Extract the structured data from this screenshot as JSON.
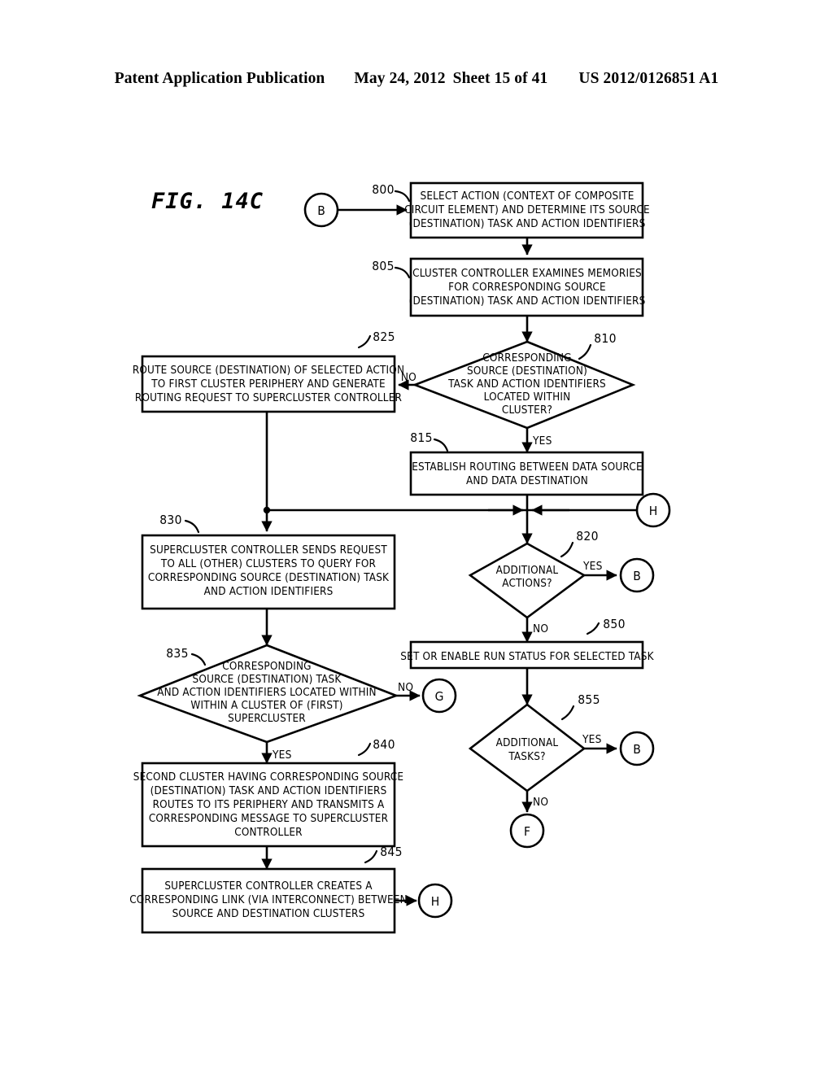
{
  "header": {
    "publication": "Patent Application Publication",
    "date": "May 24, 2012",
    "sheet": "Sheet 15 of 41",
    "number": "US 2012/0126851 A1"
  },
  "figure": {
    "label": "FIG. 14C"
  },
  "chart_data": {
    "type": "diagram",
    "title": "FIG. 14C",
    "nodes": [
      {
        "id": "800",
        "ref": "800",
        "kind": "process",
        "lines": [
          "SELECT ACTION (CONTEXT OF COMPOSITE",
          "CIRCUIT ELEMENT) AND DETERMINE ITS SOURCE",
          "(DESTINATION) TASK AND ACTION IDENTIFIERS"
        ]
      },
      {
        "id": "805",
        "ref": "805",
        "kind": "process",
        "lines": [
          "CLUSTER CONTROLLER EXAMINES MEMORIES",
          "FOR CORRESPONDING SOURCE",
          "(DESTINATION) TASK AND ACTION IDENTIFIERS"
        ]
      },
      {
        "id": "810",
        "ref": "810",
        "kind": "decision",
        "lines": [
          "CORRESPONDING",
          "SOURCE (DESTINATION)",
          "TASK AND ACTION IDENTIFIERS",
          "LOCATED WITHIN",
          "CLUSTER?"
        ]
      },
      {
        "id": "815",
        "ref": "815",
        "kind": "process",
        "lines": [
          "ESTABLISH ROUTING BETWEEN DATA SOURCE",
          "AND DATA DESTINATION"
        ]
      },
      {
        "id": "820",
        "ref": "820",
        "kind": "decision",
        "lines": [
          "ADDITIONAL",
          "ACTIONS?"
        ]
      },
      {
        "id": "825",
        "ref": "825",
        "kind": "process",
        "lines": [
          "ROUTE SOURCE (DESTINATION) OF SELECTED ACTION",
          "TO FIRST CLUSTER PERIPHERY AND GENERATE",
          "ROUTING REQUEST TO SUPERCLUSTER CONTROLLER"
        ]
      },
      {
        "id": "830",
        "ref": "830",
        "kind": "process",
        "lines": [
          "SUPERCLUSTER CONTROLLER SENDS REQUEST",
          "TO ALL (OTHER) CLUSTERS TO QUERY FOR",
          "CORRESPONDING SOURCE (DESTINATION) TASK",
          "AND ACTION IDENTIFIERS"
        ]
      },
      {
        "id": "835",
        "ref": "835",
        "kind": "decision",
        "lines": [
          "CORRESPONDING",
          "SOURCE (DESTINATION) TASK",
          "AND ACTION IDENTIFIERS LOCATED WITHIN",
          "WITHIN A CLUSTER OF (FIRST)",
          "SUPERCLUSTER"
        ]
      },
      {
        "id": "840",
        "ref": "840",
        "kind": "process",
        "lines": [
          "SECOND CLUSTER HAVING CORRESPONDING SOURCE",
          "(DESTINATION) TASK AND ACTION IDENTIFIERS",
          "ROUTES TO ITS PERIPHERY AND TRANSMITS A",
          "CORRESPONDING MESSAGE TO SUPERCLUSTER",
          "CONTROLLER"
        ]
      },
      {
        "id": "845",
        "ref": "845",
        "kind": "process",
        "lines": [
          "SUPERCLUSTER CONTROLLER CREATES A",
          "CORRESPONDING LINK (VIA INTERCONNECT) BETWEEN",
          "SOURCE AND DESTINATION CLUSTERS"
        ]
      },
      {
        "id": "850",
        "ref": "850",
        "kind": "process",
        "lines": [
          "SET OR ENABLE RUN STATUS FOR SELECTED TASK"
        ]
      },
      {
        "id": "855",
        "ref": "855",
        "kind": "decision",
        "lines": [
          "ADDITIONAL",
          "TASKS?"
        ]
      }
    ],
    "connectors": [
      {
        "id": "conn-b-in",
        "label": "B"
      },
      {
        "id": "conn-h-mid",
        "label": "H"
      },
      {
        "id": "conn-b-820",
        "label": "B"
      },
      {
        "id": "conn-g-835",
        "label": "G"
      },
      {
        "id": "conn-b-855",
        "label": "B"
      },
      {
        "id": "conn-f-855",
        "label": "F"
      },
      {
        "id": "conn-h-845",
        "label": "H"
      }
    ],
    "edge_labels": [
      {
        "id": "edge-810-no",
        "text": "NO",
        "from": "810",
        "to": "825"
      },
      {
        "id": "edge-810-yes",
        "text": "YES",
        "from": "810",
        "to": "815"
      },
      {
        "id": "edge-820-yes",
        "text": "YES",
        "from": "820",
        "to": "conn-b-820"
      },
      {
        "id": "edge-820-no",
        "text": "NO",
        "from": "820",
        "to": "850"
      },
      {
        "id": "edge-835-no",
        "text": "NO",
        "from": "835",
        "to": "conn-g-835"
      },
      {
        "id": "edge-835-yes",
        "text": "YES",
        "from": "835",
        "to": "840"
      },
      {
        "id": "edge-855-yes",
        "text": "YES",
        "from": "855",
        "to": "conn-b-855"
      },
      {
        "id": "edge-855-no",
        "text": "NO",
        "from": "855",
        "to": "conn-f-855"
      }
    ],
    "colors": {
      "ink": "#000000",
      "paper": "#ffffff"
    }
  }
}
